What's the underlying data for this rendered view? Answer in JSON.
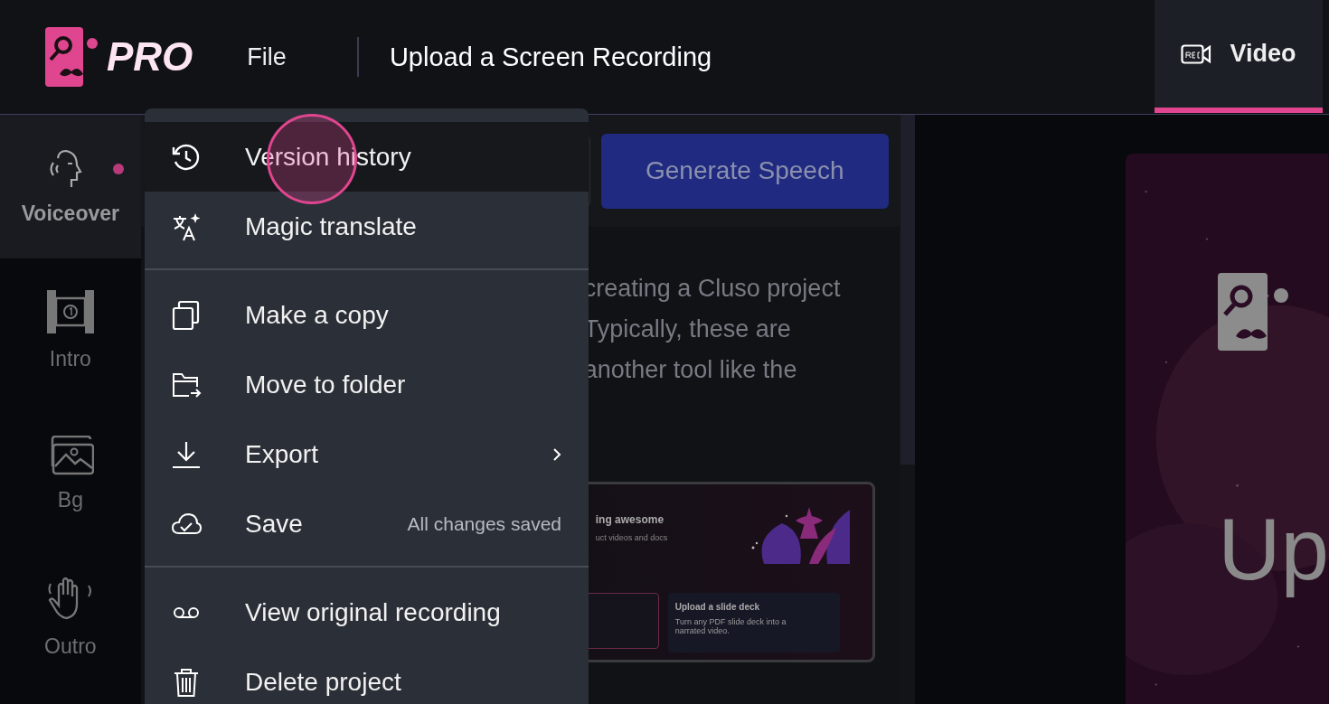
{
  "header": {
    "brand": "PRO",
    "file_menu": "File",
    "title": "Upload a Screen Recording",
    "tabs": [
      {
        "label": "Video",
        "selected": true
      }
    ]
  },
  "sidebar": {
    "items": [
      {
        "label": "Voiceover",
        "selected": true,
        "unread": true
      },
      {
        "label": "Intro",
        "selected": false,
        "unread": false
      },
      {
        "label": "Bg",
        "selected": false,
        "unread": false
      },
      {
        "label": "Outro",
        "selected": false,
        "unread": false
      }
    ]
  },
  "toolbar": {
    "generate_button": "Generate Speech"
  },
  "script_lines": [
    "creating a Cluso project",
    "Typically, these are",
    "another tool like the"
  ],
  "thumbnail": {
    "heading": "ing awesome",
    "subheading": "uct videos and docs",
    "card_title": "Upload a slide deck",
    "card_text": "Turn any PDF slide deck into a narrated video."
  },
  "preview": {
    "kind": "picture",
    "title": "Up"
  },
  "menu": {
    "sections": [
      [
        {
          "label": "Version history",
          "highlighted": true
        },
        {
          "label": "Magic translate",
          "highlighted": false
        }
      ],
      [
        {
          "label": "Make a copy",
          "highlighted": false
        },
        {
          "label": "Move to folder",
          "highlighted": false
        },
        {
          "label": "Export",
          "highlighted": false,
          "submenu": true
        },
        {
          "label": "Save",
          "highlighted": false,
          "status": "All changes saved"
        }
      ],
      [
        {
          "label": "View original recording",
          "highlighted": false
        },
        {
          "label": "Delete project",
          "highlighted": false
        }
      ]
    ]
  },
  "click_indicator": true
}
